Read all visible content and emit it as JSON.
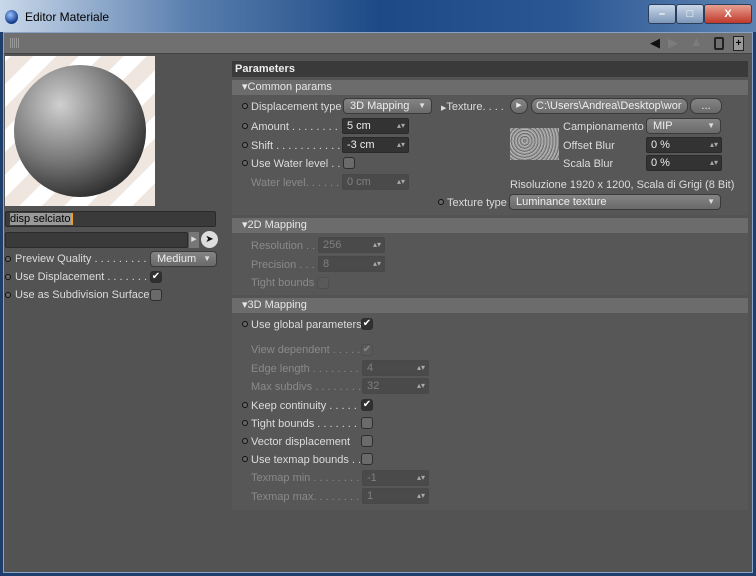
{
  "window": {
    "title": "Editor Materiale",
    "minimize": "–",
    "maximize": "□",
    "close": "X"
  },
  "toolbar": {
    "icons": [
      "grip-icon",
      "back-arrow-icon",
      "forward-arrow-icon",
      "up-arrow-icon",
      "lock-icon",
      "new-panel-icon"
    ]
  },
  "left": {
    "material_name": "disp selciato",
    "link_value": "",
    "preview_quality": {
      "label": "Preview Quality . . . . . . . . .",
      "value": "Medium"
    },
    "use_displacement": {
      "label": "Use Displacement . . . . . . .",
      "checked": true,
      "mark": "✔"
    },
    "use_subdivision": {
      "label": "Use as Subdivision Surface",
      "checked": false
    }
  },
  "params": {
    "header": "Parameters",
    "common": {
      "title": "Common params",
      "displacement_type": {
        "label": "Displacement type",
        "value": "3D Mapping"
      },
      "amount": {
        "label": "Amount . . . . . . . . . .",
        "value": "5 cm"
      },
      "shift": {
        "label": "Shift . . . . . . . . . . . .",
        "value": "-3 cm"
      },
      "use_water": {
        "label": "Use Water level . .",
        "checked": false
      },
      "water_level": {
        "label": "Water level. . . . . . .",
        "value": "0 cm"
      },
      "texture": {
        "label": "Texture. . . .",
        "path": "C:\\Users\\Andrea\\Desktop\\wor",
        "browse": "..."
      },
      "campionamento": {
        "label": "Campionamento",
        "value": "MIP"
      },
      "offset_blur": {
        "label": "Offset Blur",
        "value": "0 %"
      },
      "scala_blur": {
        "label": "Scala Blur",
        "value": "0 %"
      },
      "info": "Risoluzione 1920 x 1200, Scala di Grigi (8 Bit)",
      "texture_type": {
        "label": "Texture type",
        "value": "Luminance texture"
      }
    },
    "mapping2d": {
      "title": "2D Mapping",
      "resolution": {
        "label": "Resolution . .",
        "value": "256"
      },
      "precision": {
        "label": "Precision . . .",
        "value": "8"
      },
      "tight_bounds": {
        "label": "Tight bounds",
        "checked": false
      }
    },
    "mapping3d": {
      "title": "3D Mapping",
      "use_global": {
        "label": "Use global parameters",
        "checked": true
      },
      "view_dependent": {
        "label": "View dependent . . . . .",
        "checked": true
      },
      "edge_length": {
        "label": "Edge length . . . . . . . .",
        "value": "4"
      },
      "max_subdivs": {
        "label": "Max subdivs . . . . . . . .",
        "value": "32"
      },
      "keep_continuity": {
        "label": "Keep continuity . . . . .",
        "checked": true
      },
      "tight_bounds": {
        "label": "Tight bounds . . . . . . .",
        "checked": false
      },
      "vector_displacement": {
        "label": "Vector displacement",
        "checked": false
      },
      "use_texmap_bounds": {
        "label": "Use texmap bounds . .",
        "checked": false
      },
      "texmap_min": {
        "label": "Texmap min . . . . . . . .",
        "value": "-1"
      },
      "texmap_max": {
        "label": "Texmap max. . . . . . . .",
        "value": "1"
      }
    },
    "check_mark": "✔"
  }
}
